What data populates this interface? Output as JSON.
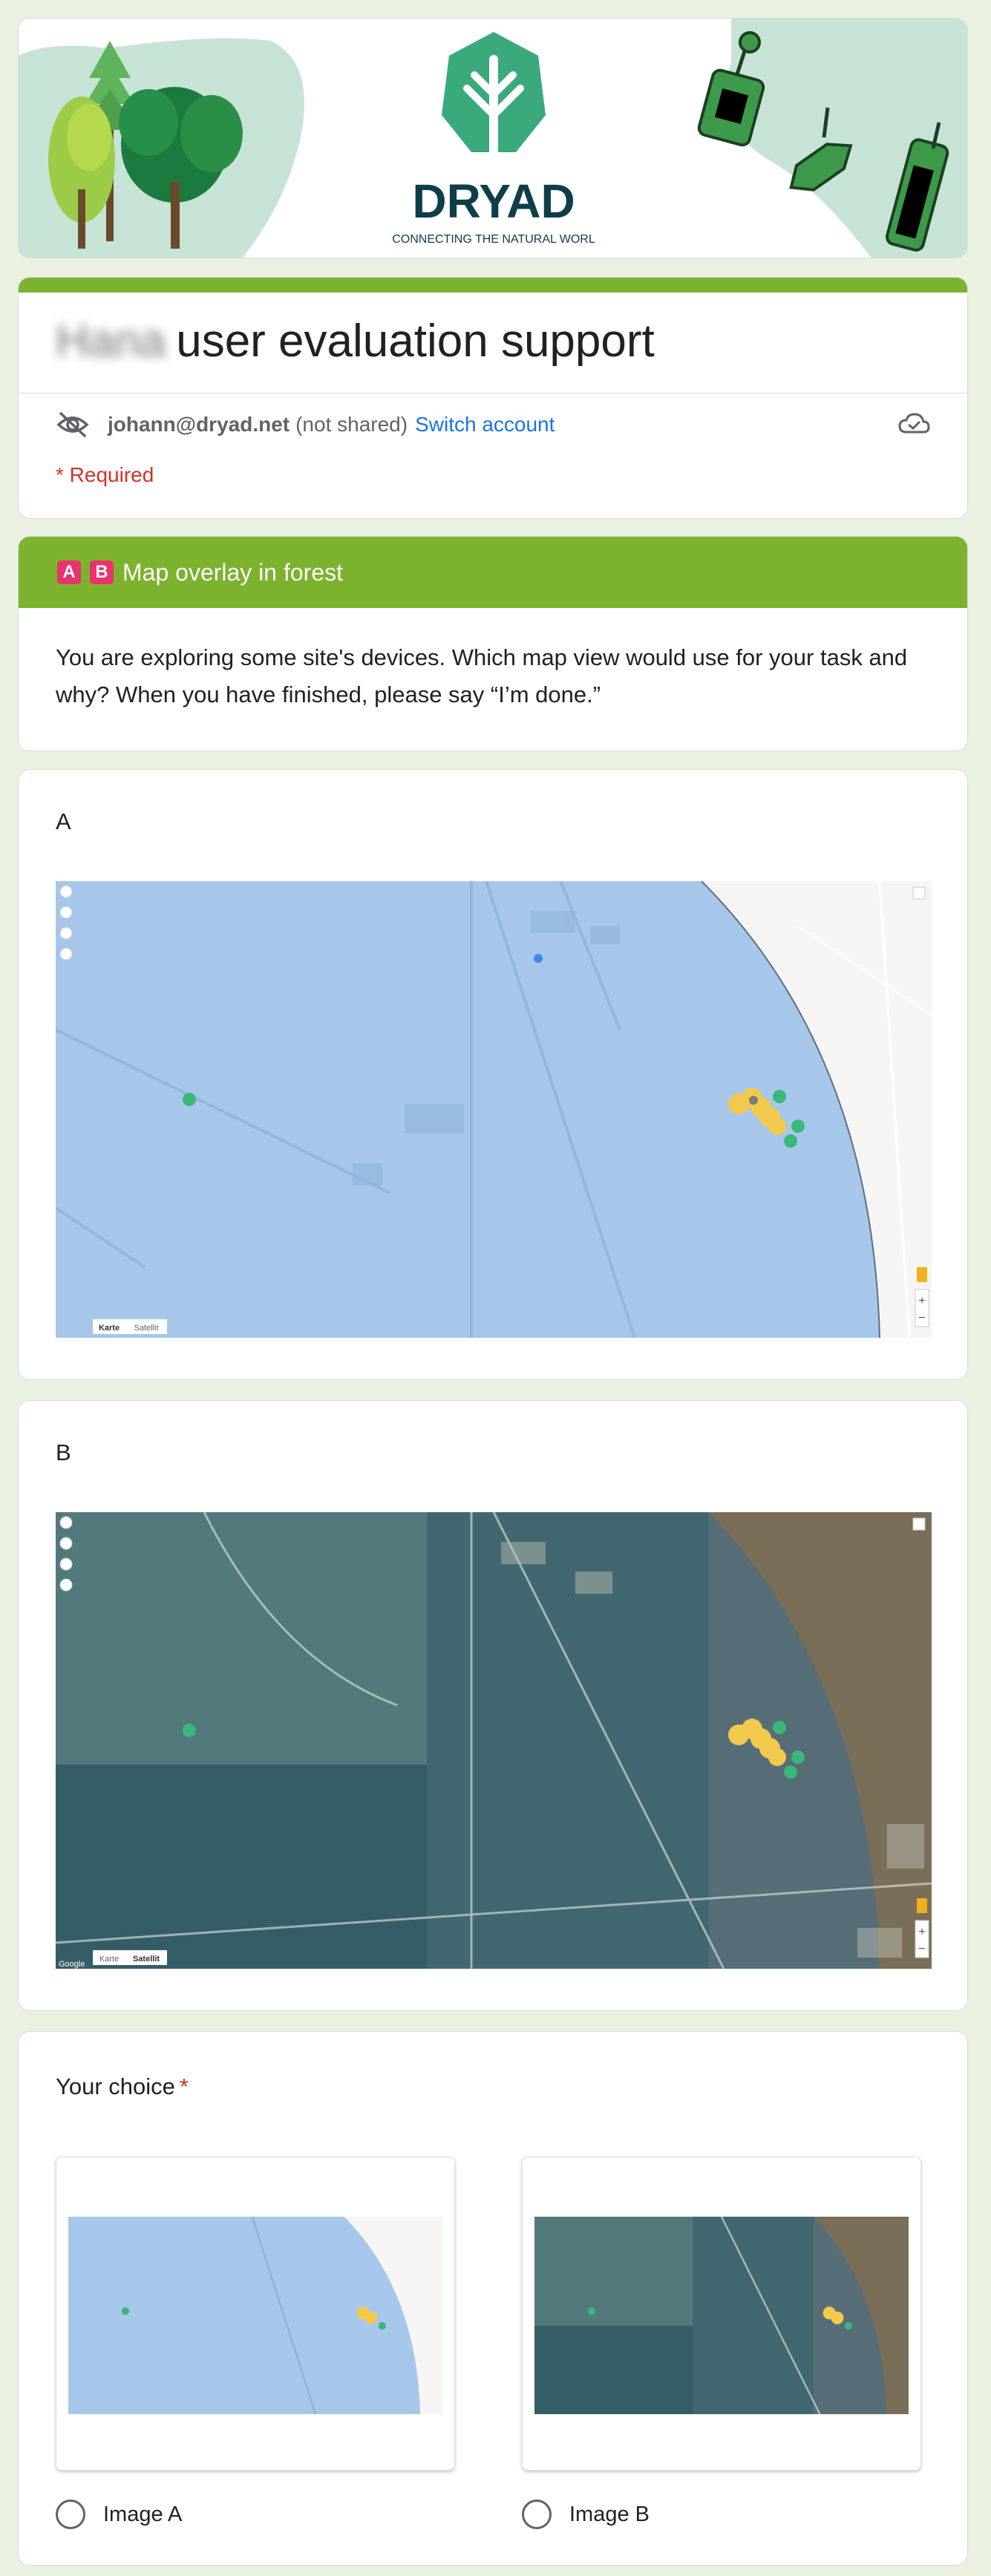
{
  "banner": {
    "logo_text": "DRYAD",
    "tagline": "CONNECTING THE NATURAL WORL"
  },
  "form": {
    "title_blurred": "Hana",
    "title": "user evaluation support",
    "account_email": "johann@dryad.net",
    "account_note": "(not shared)",
    "switch_account": "Switch account",
    "required_note": "* Required"
  },
  "section": {
    "badge_a": "A",
    "badge_b": "B",
    "title": "Map overlay in forest",
    "description": "You are exploring some site's devices. Which map view would use for your task and why? When you have finished, please say “I’m done.”"
  },
  "question_a": {
    "label": "A",
    "map_type_tabs": [
      "Karte",
      "Satellit"
    ],
    "selected_tab": "Karte"
  },
  "question_b": {
    "label": "B",
    "map_type_tabs": [
      "Karte",
      "Satellit"
    ],
    "selected_tab": "Satellit",
    "attribution": "Google"
  },
  "choice": {
    "title": "Your choice",
    "required_marker": "*",
    "option_a": "Image A",
    "option_b": "Image B"
  },
  "colors": {
    "accent_green": "#7cb22e",
    "page_background": "#eaf1e0",
    "link_blue": "#1a73e8",
    "required_red": "#d93025",
    "badge_pink": "#e8336b",
    "dryad_teal": "#3aaa7c",
    "dryad_navy": "#0f3d4a"
  }
}
